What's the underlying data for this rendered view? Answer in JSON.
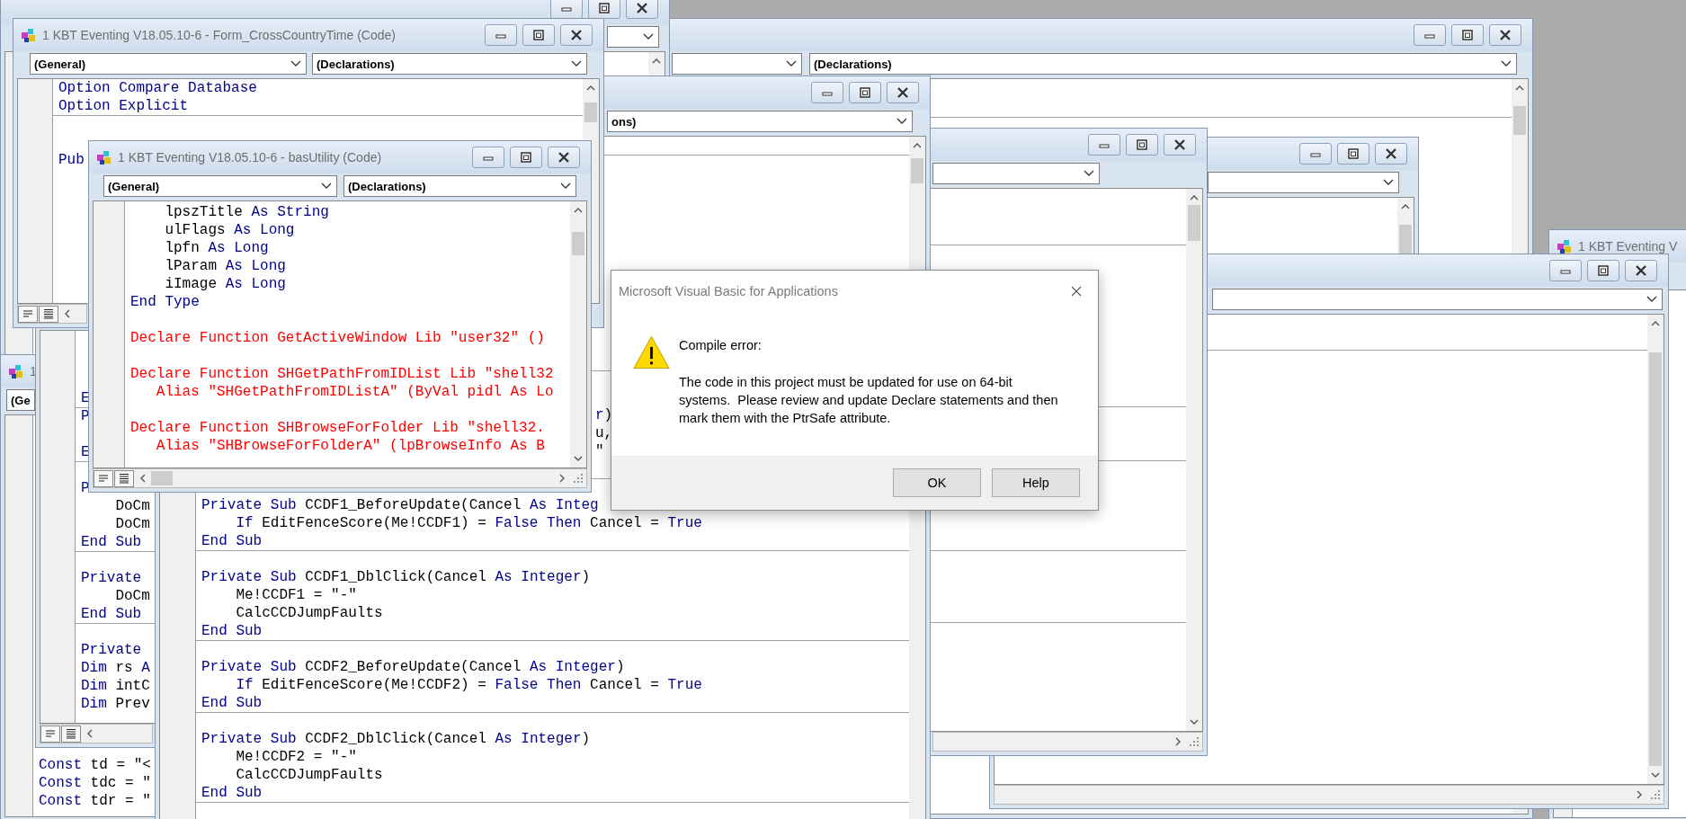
{
  "windows": [
    {
      "procedure_box": "(Declarations)"
    },
    {
      "title": "1 KBT Eventing V"
    },
    {
      "title": "1",
      "object_box": "(Ge",
      "lines": [
        {
          "kind": "code",
          "segments": [
            {
              "text": "Const",
              "kind": "keyword"
            },
            {
              "text": " td = \"<",
              "kind": "plain"
            }
          ]
        },
        {
          "kind": "code",
          "segments": [
            {
              "text": "Const",
              "kind": "keyword"
            },
            {
              "text": " tdc = \"",
              "kind": "plain"
            }
          ]
        },
        {
          "kind": "code",
          "segments": [
            {
              "text": "Const",
              "kind": "keyword"
            },
            {
              "text": " tdr = \"",
              "kind": "plain"
            }
          ]
        }
      ]
    },
    {
      "lines": [
        {
          "kind": "code",
          "segments": [
            {
              "text": "E",
              "kind": "keyword"
            }
          ]
        },
        {
          "kind": "separator"
        },
        {
          "kind": "code",
          "segments": [
            {
              "text": "P",
              "kind": "keyword"
            }
          ]
        },
        {
          "kind": "blank"
        },
        {
          "kind": "code",
          "segments": [
            {
              "text": "E",
              "kind": "keyword"
            }
          ]
        },
        {
          "kind": "separator"
        },
        {
          "kind": "blank"
        },
        {
          "kind": "code",
          "segments": [
            {
              "text": "P",
              "kind": "keyword"
            }
          ]
        },
        {
          "kind": "code",
          "segments": [
            {
              "text": "    DoCm",
              "kind": "plain"
            }
          ]
        },
        {
          "kind": "code",
          "segments": [
            {
              "text": "    DoCm",
              "kind": "plain"
            }
          ]
        },
        {
          "kind": "code",
          "segments": [
            {
              "text": "End Sub",
              "kind": "keyword"
            }
          ]
        },
        {
          "kind": "separator"
        },
        {
          "kind": "blank"
        },
        {
          "kind": "code",
          "segments": [
            {
              "text": "Private",
              "kind": "keyword"
            }
          ]
        },
        {
          "kind": "code",
          "segments": [
            {
              "text": "    DoCm",
              "kind": "plain"
            }
          ]
        },
        {
          "kind": "code",
          "segments": [
            {
              "text": "End Sub",
              "kind": "keyword"
            }
          ]
        },
        {
          "kind": "separator"
        },
        {
          "kind": "blank"
        },
        {
          "kind": "code",
          "segments": [
            {
              "text": "Private",
              "kind": "keyword"
            }
          ]
        },
        {
          "kind": "code",
          "segments": [
            {
              "text": "Dim",
              "kind": "keyword"
            },
            {
              "text": " rs ",
              "kind": "plain"
            },
            {
              "text": "A",
              "kind": "keyword"
            }
          ]
        },
        {
          "kind": "code",
          "segments": [
            {
              "text": "Dim",
              "kind": "keyword"
            },
            {
              "text": " intC",
              "kind": "plain"
            }
          ]
        },
        {
          "kind": "code",
          "segments": [
            {
              "text": "Dim",
              "kind": "keyword"
            },
            {
              "text": " Prev",
              "kind": "plain"
            }
          ]
        }
      ]
    },
    {
      "procedure_box": "ons)",
      "lines": [
        {
          "kind": "blank"
        },
        {
          "kind": "separator"
        },
        {
          "kind": "blank"
        },
        {
          "kind": "blank"
        },
        {
          "kind": "blank"
        },
        {
          "kind": "blank"
        },
        {
          "kind": "blank"
        },
        {
          "kind": "blank"
        },
        {
          "kind": "blank"
        },
        {
          "kind": "blank"
        },
        {
          "kind": "blank"
        },
        {
          "kind": "blank"
        },
        {
          "kind": "blank"
        },
        {
          "kind": "blank"
        },
        {
          "kind": "separator"
        },
        {
          "kind": "blank"
        },
        {
          "kind": "blank"
        },
        {
          "kind": "clipped",
          "segments": [
            {
              "text": "r",
              "kind": "keyword"
            },
            {
              "text": ")",
              "kind": "plain"
            }
          ]
        },
        {
          "kind": "clipped",
          "segments": [
            {
              "text": "u,",
              "kind": "plain"
            }
          ]
        },
        {
          "kind": "clipped",
          "segments": [
            {
              "text": "\"",
              "kind": "plain"
            }
          ]
        },
        {
          "kind": "blank"
        },
        {
          "kind": "separator"
        },
        {
          "kind": "blank"
        },
        {
          "kind": "code",
          "segments": [
            {
              "text": "Private Sub",
              "kind": "keyword"
            },
            {
              "text": " CCDF1_BeforeUpdate(Cancel ",
              "kind": "plain"
            },
            {
              "text": "As Integ",
              "kind": "keyword"
            }
          ]
        },
        {
          "kind": "code",
          "segments": [
            {
              "text": "    If",
              "kind": "keyword"
            },
            {
              "text": " EditFenceScore(Me!CCDF1) = ",
              "kind": "plain"
            },
            {
              "text": "False Then",
              "kind": "keyword"
            },
            {
              "text": " Cancel = ",
              "kind": "plain"
            },
            {
              "text": "True",
              "kind": "keyword"
            }
          ]
        },
        {
          "kind": "code",
          "segments": [
            {
              "text": "End Sub",
              "kind": "keyword"
            }
          ]
        },
        {
          "kind": "separator"
        },
        {
          "kind": "blank"
        },
        {
          "kind": "code",
          "segments": [
            {
              "text": "Private Sub",
              "kind": "keyword"
            },
            {
              "text": " CCDF1_DblClick(Cancel ",
              "kind": "plain"
            },
            {
              "text": "As Integer",
              "kind": "keyword"
            },
            {
              "text": ")",
              "kind": "plain"
            }
          ]
        },
        {
          "kind": "code",
          "segments": [
            {
              "text": "    Me!CCDF1 = \"-\"",
              "kind": "plain"
            }
          ]
        },
        {
          "kind": "code",
          "segments": [
            {
              "text": "    CalcCCDJumpFaults",
              "kind": "plain"
            }
          ]
        },
        {
          "kind": "code",
          "segments": [
            {
              "text": "End Sub",
              "kind": "keyword"
            }
          ]
        },
        {
          "kind": "separator"
        },
        {
          "kind": "blank"
        },
        {
          "kind": "code",
          "segments": [
            {
              "text": "Private Sub",
              "kind": "keyword"
            },
            {
              "text": " CCDF2_BeforeUpdate(Cancel ",
              "kind": "plain"
            },
            {
              "text": "As Integer",
              "kind": "keyword"
            },
            {
              "text": ")",
              "kind": "plain"
            }
          ]
        },
        {
          "kind": "code",
          "segments": [
            {
              "text": "    If",
              "kind": "keyword"
            },
            {
              "text": " EditFenceScore(Me!CCDF2) = ",
              "kind": "plain"
            },
            {
              "text": "False Then",
              "kind": "keyword"
            },
            {
              "text": " Cancel = ",
              "kind": "plain"
            },
            {
              "text": "True",
              "kind": "keyword"
            }
          ]
        },
        {
          "kind": "code",
          "segments": [
            {
              "text": "End Sub",
              "kind": "keyword"
            }
          ]
        },
        {
          "kind": "separator"
        },
        {
          "kind": "blank"
        },
        {
          "kind": "code",
          "segments": [
            {
              "text": "Private Sub",
              "kind": "keyword"
            },
            {
              "text": " CCDF2_DblClick(Cancel ",
              "kind": "plain"
            },
            {
              "text": "As Integer",
              "kind": "keyword"
            },
            {
              "text": ")",
              "kind": "plain"
            }
          ]
        },
        {
          "kind": "code",
          "segments": [
            {
              "text": "    Me!CCDF2 = \"-\"",
              "kind": "plain"
            }
          ]
        },
        {
          "kind": "code",
          "segments": [
            {
              "text": "    CalcCCDJumpFaults",
              "kind": "plain"
            }
          ]
        },
        {
          "kind": "code",
          "segments": [
            {
              "text": "End Sub",
              "kind": "keyword"
            }
          ]
        },
        {
          "kind": "separator"
        }
      ]
    },
    {
      "title": "1 KBT Eventing V18.05.10-6 - Form_CrossCountryTime (Code)",
      "object_box": "(General)",
      "procedure_box": "(Declarations)",
      "lines": [
        {
          "kind": "code",
          "segments": [
            {
              "text": "Option Compare Database",
              "kind": "keyword"
            }
          ]
        },
        {
          "kind": "code",
          "segments": [
            {
              "text": "Option Explicit",
              "kind": "keyword"
            }
          ]
        },
        {
          "kind": "separator"
        },
        {
          "kind": "blank"
        },
        {
          "kind": "blank"
        },
        {
          "kind": "code",
          "segments": [
            {
              "text": "Pub",
              "kind": "keyword"
            }
          ]
        }
      ]
    },
    {
      "title": "1 KBT Eventing V18.05.10-6 - basUtility (Code)",
      "object_box": "(General)",
      "procedure_box": "(Declarations)",
      "lines": [
        {
          "kind": "code",
          "segments": [
            {
              "text": "    lpszTitle ",
              "kind": "plain"
            },
            {
              "text": "As String",
              "kind": "keyword"
            }
          ]
        },
        {
          "kind": "code",
          "segments": [
            {
              "text": "    ulFlags ",
              "kind": "plain"
            },
            {
              "text": "As Long",
              "kind": "keyword"
            }
          ]
        },
        {
          "kind": "code",
          "segments": [
            {
              "text": "    lpfn ",
              "kind": "plain"
            },
            {
              "text": "As Long",
              "kind": "keyword"
            }
          ]
        },
        {
          "kind": "code",
          "segments": [
            {
              "text": "    lParam ",
              "kind": "plain"
            },
            {
              "text": "As Long",
              "kind": "keyword"
            }
          ]
        },
        {
          "kind": "code",
          "segments": [
            {
              "text": "    iImage ",
              "kind": "plain"
            },
            {
              "text": "As Long",
              "kind": "keyword"
            }
          ]
        },
        {
          "kind": "code",
          "segments": [
            {
              "text": "End Type",
              "kind": "keyword"
            }
          ]
        },
        {
          "kind": "blank"
        },
        {
          "kind": "code",
          "segments": [
            {
              "text": "Declare Function GetActiveWindow Lib \"user32\" ()",
              "kind": "error"
            }
          ]
        },
        {
          "kind": "blank"
        },
        {
          "kind": "code",
          "segments": [
            {
              "text": "Declare Function SHGetPathFromIDList Lib \"shell32",
              "kind": "error"
            }
          ]
        },
        {
          "kind": "code",
          "segments": [
            {
              "text": "   Alias \"SHGetPathFromIDListA\" (ByVal pidl As Lo",
              "kind": "error"
            }
          ]
        },
        {
          "kind": "blank"
        },
        {
          "kind": "code",
          "segments": [
            {
              "text": "Declare Function SHBrowseForFolder Lib \"shell32.",
              "kind": "error"
            }
          ]
        },
        {
          "kind": "code",
          "segments": [
            {
              "text": "   Alias \"SHBrowseForFolderA\" (lpBrowseInfo As B",
              "kind": "error"
            }
          ]
        }
      ]
    }
  ],
  "dialog": {
    "title": "Microsoft Visual Basic for Applications",
    "heading": "Compile error:",
    "message": "The code in this project must be updated for use on 64-bit systems.  Please review and update Declare statements and then mark them with the PtrSafe attribute.",
    "buttons": [
      "OK",
      "Help"
    ]
  }
}
